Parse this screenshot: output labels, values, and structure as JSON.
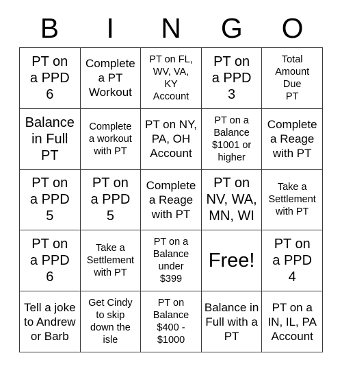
{
  "card": {
    "headers": [
      "B",
      "I",
      "N",
      "G",
      "O"
    ],
    "cells": [
      {
        "text": "PT on\na PPD\n6",
        "size": "size-lg"
      },
      {
        "text": "Complete\na PT\nWorkout",
        "size": "size-md"
      },
      {
        "text": "PT on FL,\nWV, VA,\nKY\nAccount",
        "size": "size-sm"
      },
      {
        "text": "PT on\na PPD\n3",
        "size": "size-lg"
      },
      {
        "text": "Total\nAmount\nDue\nPT",
        "size": "size-sm"
      },
      {
        "text": "Balance\nin Full\nPT",
        "size": "size-lg"
      },
      {
        "text": "Complete\na workout\nwith PT",
        "size": "size-sm"
      },
      {
        "text": "PT on NY,\nPA, OH\nAccount",
        "size": "size-md"
      },
      {
        "text": "PT on a\nBalance\n$1001 or\nhigher",
        "size": "size-sm"
      },
      {
        "text": "Complete\na Reage\nwith PT",
        "size": "size-md"
      },
      {
        "text": "PT on\na PPD\n5",
        "size": "size-lg"
      },
      {
        "text": "PT on\na PPD\n5",
        "size": "size-lg"
      },
      {
        "text": "Complete\na Reage\nwith PT",
        "size": "size-md"
      },
      {
        "text": "PT on\nNV, WA,\nMN, WI",
        "size": "size-lg"
      },
      {
        "text": "Take a\nSettlement\nwith PT",
        "size": "size-sm"
      },
      {
        "text": "PT on\na PPD\n6",
        "size": "size-lg"
      },
      {
        "text": "Take a\nSettlement\nwith PT",
        "size": "size-sm"
      },
      {
        "text": "PT on a\nBalance\nunder\n$399",
        "size": "size-sm"
      },
      {
        "text": "Free!",
        "size": "size-xl"
      },
      {
        "text": "PT on\na PPD\n4",
        "size": "size-lg"
      },
      {
        "text": "Tell a joke\nto Andrew\nor Barb",
        "size": "size-md"
      },
      {
        "text": "Get Cindy\nto skip\ndown the\nisle",
        "size": "size-sm"
      },
      {
        "text": "PT on\nBalance\n$400 -\n$1000",
        "size": "size-sm"
      },
      {
        "text": "Balance in\nFull with a\nPT",
        "size": "size-md"
      },
      {
        "text": "PT on a\nIN, IL, PA\nAccount",
        "size": "size-md"
      }
    ],
    "colors": {
      "border": "#3a3a3a",
      "text": "#000000",
      "background": "#ffffff"
    }
  }
}
